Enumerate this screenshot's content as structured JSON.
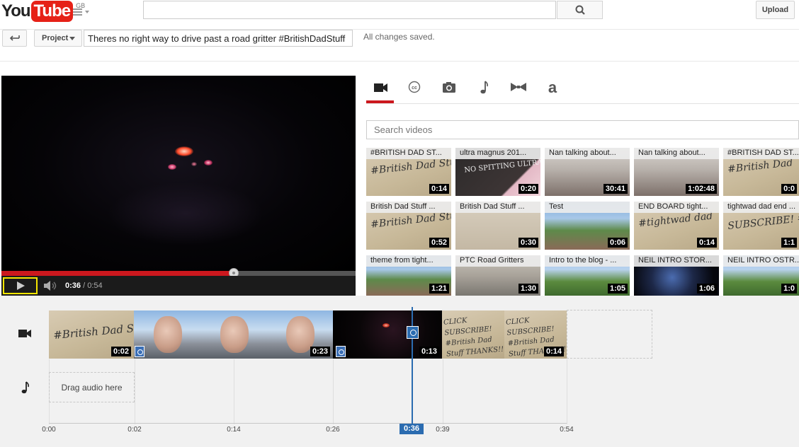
{
  "masthead": {
    "logo_you": "You",
    "logo_tube": "Tube",
    "logo_region": "GB",
    "search_placeholder": "",
    "upload_label": "Upload"
  },
  "editor": {
    "project_label": "Project",
    "title_value": "Theres no right way to drive past a road gritter #BritishDadStuff",
    "save_status": "All changes saved."
  },
  "player": {
    "current_time": "0:36",
    "separator": "/",
    "duration": "0:54",
    "progress_fraction": 0.655
  },
  "tabs": [
    {
      "name": "videos",
      "icon": "video-camera-icon",
      "active": true
    },
    {
      "name": "captions",
      "icon": "cc-icon",
      "active": false
    },
    {
      "name": "photos",
      "icon": "camera-icon",
      "active": false
    },
    {
      "name": "audio",
      "icon": "music-note-icon",
      "active": false
    },
    {
      "name": "transitions",
      "icon": "bowtie-icon",
      "active": false
    },
    {
      "name": "text",
      "icon": "letter-a-icon",
      "active": false
    }
  ],
  "video_search": {
    "placeholder": "Search videos"
  },
  "thumbnails": [
    {
      "title": "#BRITISH DAD ST...",
      "duration": "0:14",
      "style": "paper",
      "text": "#British Dad Stuff"
    },
    {
      "title": "ultra magnus 201...",
      "duration": "0:20",
      "style": "chalk",
      "text": "NO SPITTING ULTRA MAGNUS"
    },
    {
      "title": "Nan talking about...",
      "duration": "30:41",
      "style": "room",
      "text": ""
    },
    {
      "title": "Nan talking about...",
      "duration": "1:02:48",
      "style": "room",
      "text": ""
    },
    {
      "title": "#BRITISH DAD ST...",
      "duration": "0:0",
      "style": "paper",
      "text": "#British Dad"
    },
    {
      "title": "British Dad Stuff ...",
      "duration": "0:52",
      "style": "paper",
      "text": "#British Dad Stuff"
    },
    {
      "title": "British Dad Stuff ...",
      "duration": "0:30",
      "style": "plain",
      "text": ""
    },
    {
      "title": "Test",
      "duration": "0:06",
      "style": "garden",
      "text": ""
    },
    {
      "title": "END BOARD tight...",
      "duration": "0:14",
      "style": "paper",
      "text": "#tightwad dad"
    },
    {
      "title": "tightwad dad end ...",
      "duration": "1:1",
      "style": "paper",
      "text": "SUBSCRIBE! #tightwad"
    },
    {
      "title": "theme from tight...",
      "duration": "1:21",
      "style": "garden",
      "text": ""
    },
    {
      "title": "PTC Road Gritters",
      "duration": "1:30",
      "style": "street",
      "text": ""
    },
    {
      "title": "Intro to the blog - ...",
      "duration": "1:05",
      "style": "field",
      "text": ""
    },
    {
      "title": "NEIL INTRO STOR...",
      "duration": "1:06",
      "style": "dark",
      "text": ""
    },
    {
      "title": "NEIL INTRO OSTR...",
      "duration": "1:0",
      "style": "field",
      "text": ""
    }
  ],
  "timeline": {
    "clips": [
      {
        "style": "paper",
        "duration": "0:02",
        "text": "#British Dad Stuff"
      },
      {
        "style": "face",
        "duration": "",
        "text": ""
      },
      {
        "style": "face",
        "duration": "",
        "text": ""
      },
      {
        "style": "face",
        "duration": "0:23",
        "text": ""
      },
      {
        "style": "night",
        "duration": "0:13",
        "text": ""
      },
      {
        "style": "paper",
        "duration": "",
        "text": "CLICK SUBSCRIBE! #British Dad Stuff THANKS!!"
      },
      {
        "style": "paper",
        "duration": "0:14",
        "text": "CLICK SUBSCRIBE! #British Dad Stuff THANKS!!"
      }
    ],
    "drag_audio_label": "Drag audio here",
    "ticks": [
      "0:00",
      "0:02",
      "0:14",
      "0:26",
      "0:39",
      "0:54"
    ],
    "playhead_label": "0:36"
  },
  "colors": {
    "accent_red": "#cc181e",
    "playhead_blue": "#2b6cb0",
    "focus_yellow": "#f6e600"
  }
}
